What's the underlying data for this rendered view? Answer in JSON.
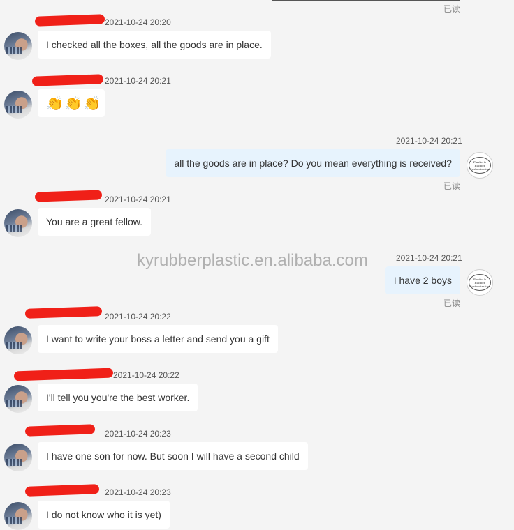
{
  "watermark": "kyrubberplastic.en.alibaba.com",
  "read_label": "已读",
  "my_avatar_text": "Plastic & Rubber Customization",
  "messages": [
    {
      "sender": "them",
      "time": "2021-10-24 20:20",
      "text": "I checked all the boxes, all the goods are in place."
    },
    {
      "sender": "them",
      "time": "2021-10-24 20:21",
      "text": "👏👏👏",
      "emoji_names": [
        "clap-emoji",
        "clap-emoji",
        "clap-emoji"
      ]
    },
    {
      "sender": "me",
      "time": "2021-10-24 20:21",
      "text": "all the goods are in place? Do you mean everything is received?",
      "read": true
    },
    {
      "sender": "them",
      "time": "2021-10-24 20:21",
      "text": "You are a great fellow."
    },
    {
      "sender": "me",
      "time": "2021-10-24 20:21",
      "text": "I have 2 boys",
      "read": true
    },
    {
      "sender": "them",
      "time": "2021-10-24 20:22",
      "text": "I want to write your boss a letter and send you a gift"
    },
    {
      "sender": "them",
      "time": "2021-10-24 20:22",
      "text": "I'll tell you you're the best worker."
    },
    {
      "sender": "them",
      "time": "2021-10-24 20:23",
      "text": "I have one son for now. But soon I will have a second child"
    },
    {
      "sender": "them",
      "time": "2021-10-24 20:23",
      "text": "I do not know who it is yet)"
    }
  ],
  "colors": {
    "background": "#f4f4f4",
    "their_bubble": "#ffffff",
    "my_bubble": "#e7f3fd",
    "redaction": "#f02018"
  }
}
